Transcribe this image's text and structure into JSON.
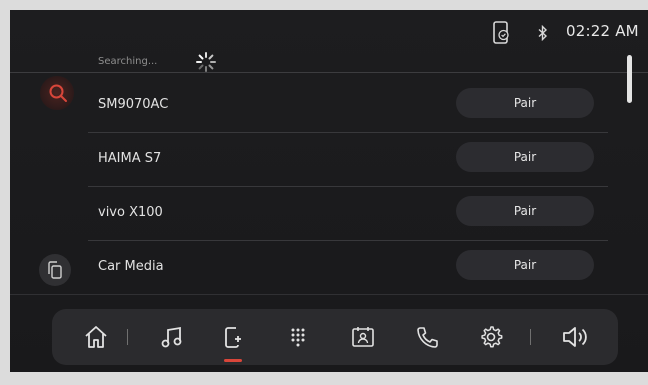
{
  "status_bar": {
    "time": "02:22 AM",
    "phone_icon": "phone-connected-icon",
    "bluetooth_icon": "bluetooth-icon"
  },
  "search": {
    "status_text": "Searching...",
    "spinner_icon": "loading-spinner-icon"
  },
  "side_buttons": {
    "search_icon": "search-icon",
    "copy_icon": "copy-icon",
    "search_accent": "#d9463a"
  },
  "devices": [
    {
      "name": "SM9070AC",
      "action": "Pair"
    },
    {
      "name": "HAIMA S7",
      "action": "Pair"
    },
    {
      "name": "vivo X100",
      "action": "Pair"
    },
    {
      "name": "Car Media",
      "action": "Pair"
    }
  ],
  "dock": {
    "items": [
      "home-icon",
      "music-icon",
      "phone-link-icon",
      "apps-grid-icon",
      "contacts-icon",
      "phone-call-icon",
      "settings-icon",
      "volume-icon"
    ],
    "active_item": "phone-link-icon",
    "active_color": "#d9463a"
  }
}
